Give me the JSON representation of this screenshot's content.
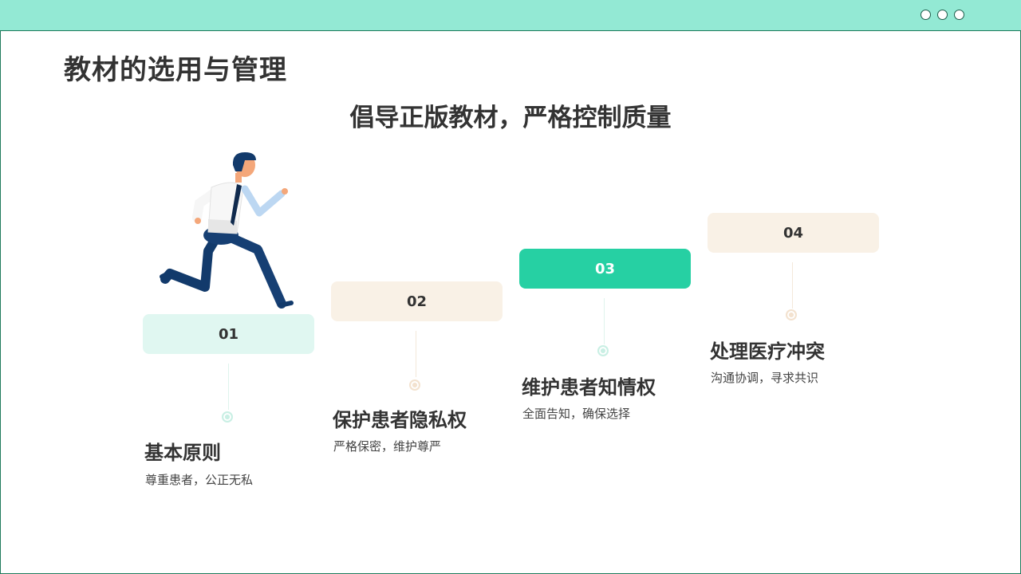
{
  "page": {
    "title": "教材的选用与管理",
    "subtitle": "倡导正版教材，严格控制质量"
  },
  "steps": [
    {
      "number": "01",
      "title": "基本原则",
      "desc": "尊重患者，公正无私",
      "box_color": "#e0f7f1",
      "dot_color": "#c9efe4",
      "active": false
    },
    {
      "number": "02",
      "title": "保护患者隐私权",
      "desc": "严格保密，维护尊严",
      "box_color": "#f9f1e6",
      "dot_color": "#f3e2cf",
      "active": false
    },
    {
      "number": "03",
      "title": "维护患者知情权",
      "desc": "全面告知，确保选择",
      "box_color": "#26d0a3",
      "dot_color": "#c9efe4",
      "active": true
    },
    {
      "number": "04",
      "title": "处理医疗冲突",
      "desc": "沟通协调，寻求共识",
      "box_color": "#f9f1e6",
      "dot_color": "#f3e2cf",
      "active": false
    }
  ],
  "colors": {
    "accent": "#26d0a3",
    "topbar": "#93e9d4",
    "border": "#1f7a5c"
  },
  "illustration": "running-man-icon"
}
